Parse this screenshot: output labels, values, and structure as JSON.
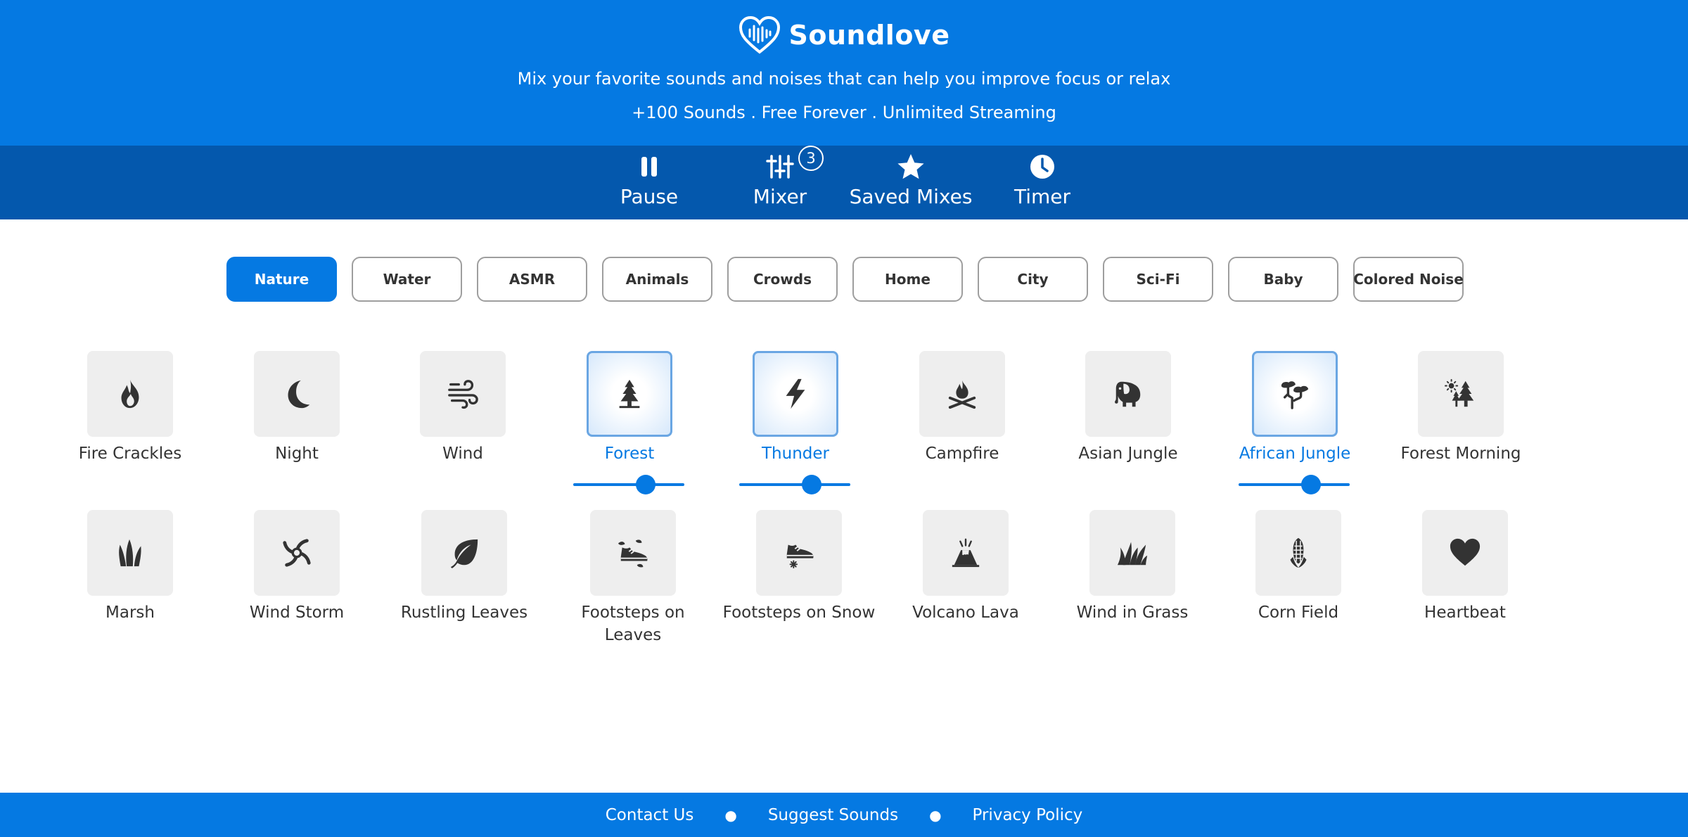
{
  "header": {
    "brand": "Soundlove",
    "tagline": "Mix your favorite sounds and noises that can help you improve focus or relax",
    "features": "+100 Sounds . Free Forever . Unlimited Streaming"
  },
  "nav": {
    "pause": "Pause",
    "mixer": "Mixer",
    "mixer_badge": "3",
    "saved": "Saved Mixes",
    "timer": "Timer"
  },
  "categories": [
    "Nature",
    "Water",
    "ASMR",
    "Animals",
    "Crowds",
    "Home",
    "City",
    "Sci-Fi",
    "Baby",
    "Colored Noise"
  ],
  "active_category": "Nature",
  "sounds_row1": [
    {
      "name": "Fire Crackles",
      "icon": "fire-icon",
      "active": false
    },
    {
      "name": "Night",
      "icon": "moon-icon",
      "active": false
    },
    {
      "name": "Wind",
      "icon": "wind-icon",
      "active": false
    },
    {
      "name": "Forest",
      "icon": "pine-tree-icon",
      "active": true,
      "volume": 0.65
    },
    {
      "name": "Thunder",
      "icon": "lightning-icon",
      "active": true,
      "volume": 0.65
    },
    {
      "name": "Campfire",
      "icon": "campfire-icon",
      "active": false
    },
    {
      "name": "Asian Jungle",
      "icon": "elephant-icon",
      "active": false
    },
    {
      "name": "African Jungle",
      "icon": "jungle-trees-icon",
      "active": true,
      "volume": 0.65
    },
    {
      "name": "Forest Morning",
      "icon": "sun-trees-icon",
      "active": false
    }
  ],
  "sounds_row2": [
    {
      "name": "Marsh",
      "icon": "reeds-icon",
      "active": false
    },
    {
      "name": "Wind Storm",
      "icon": "storm-swirl-icon",
      "active": false
    },
    {
      "name": "Rustling Leaves",
      "icon": "leaf-icon",
      "active": false
    },
    {
      "name": "Footsteps on Leaves",
      "icon": "shoe-leaves-icon",
      "active": false
    },
    {
      "name": "Footsteps on Snow",
      "icon": "shoe-snow-icon",
      "active": false
    },
    {
      "name": "Volcano Lava",
      "icon": "volcano-icon",
      "active": false
    },
    {
      "name": "Wind in Grass",
      "icon": "grass-icon",
      "active": false
    },
    {
      "name": "Corn Field",
      "icon": "corn-icon",
      "active": false
    },
    {
      "name": "Heartbeat",
      "icon": "heart-icon",
      "active": false
    }
  ],
  "footer": {
    "contact": "Contact Us",
    "suggest": "Suggest Sounds",
    "privacy": "Privacy Policy"
  },
  "colors": {
    "brand_blue": "#0579e2",
    "nav_blue": "#0458ad",
    "tile_bg": "#eeeeee",
    "text": "#333333"
  }
}
